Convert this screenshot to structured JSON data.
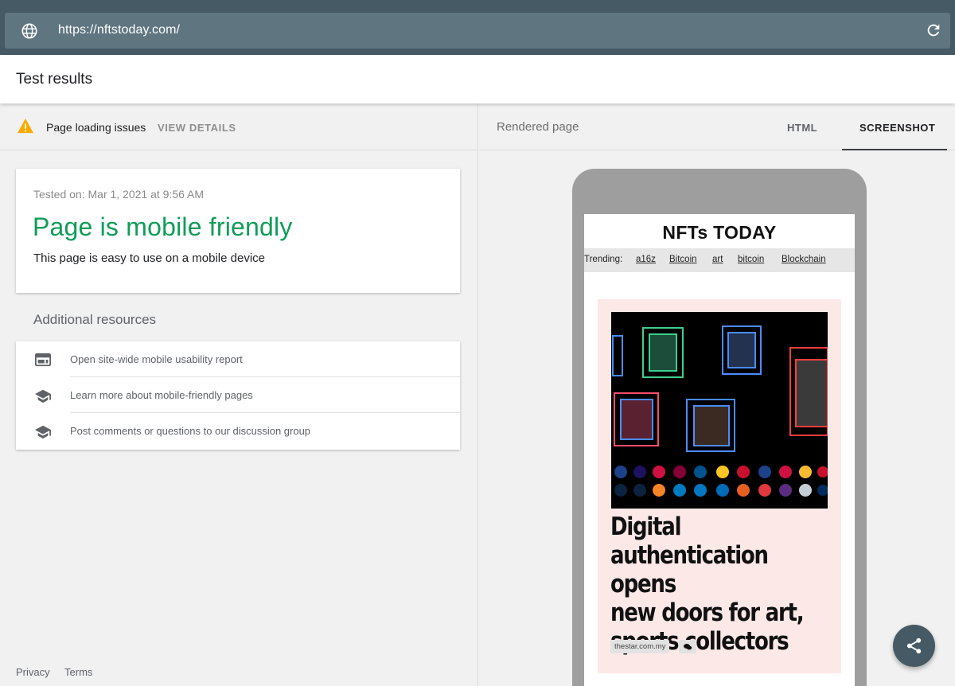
{
  "address_bar": {
    "url": "https://nftstoday.com/",
    "globe_icon": "globe-icon",
    "reload_icon": "reload-icon"
  },
  "header": {
    "title": "Test results"
  },
  "issues": {
    "icon": "warning-icon",
    "label": "Page loading issues",
    "action": "VIEW DETAILS",
    "warning_color": "#f9ab00"
  },
  "result": {
    "tested_on": "Tested on: Mar 1, 2021 at 9:56 AM",
    "verdict": "Page is mobile friendly",
    "verdict_color": "#0f9d58",
    "description": "This page is easy to use on a mobile device"
  },
  "resources": {
    "heading": "Additional resources",
    "items": [
      {
        "icon": "web-layout-icon",
        "label": "Open site-wide mobile usability report"
      },
      {
        "icon": "school-icon",
        "label": "Learn more about mobile-friendly pages"
      },
      {
        "icon": "school-icon",
        "label": "Post comments or questions to our discussion group"
      }
    ]
  },
  "footer": {
    "privacy": "Privacy",
    "terms": "Terms"
  },
  "preview": {
    "label": "Rendered page",
    "tabs": [
      {
        "label": "HTML",
        "selected": false
      },
      {
        "label": "SCREENSHOT",
        "selected": true
      }
    ]
  },
  "rendered_site": {
    "title": "NFTs TODAY",
    "trending_label": "Trending:",
    "trending_links": [
      "a16z",
      "Bitcoin",
      "art",
      "bitcoin",
      "Blockchain"
    ],
    "article_title": "Digital authentication opens new doors for art, sports collectors",
    "article_title_lines": [
      "Digital",
      "authentication opens",
      "new doors for art,",
      "sports collectors"
    ],
    "source": "thestar.com.my",
    "comment_icon": "comment-icon",
    "article_background": "#fde8e8"
  },
  "share_button": {
    "icon": "share-icon"
  }
}
